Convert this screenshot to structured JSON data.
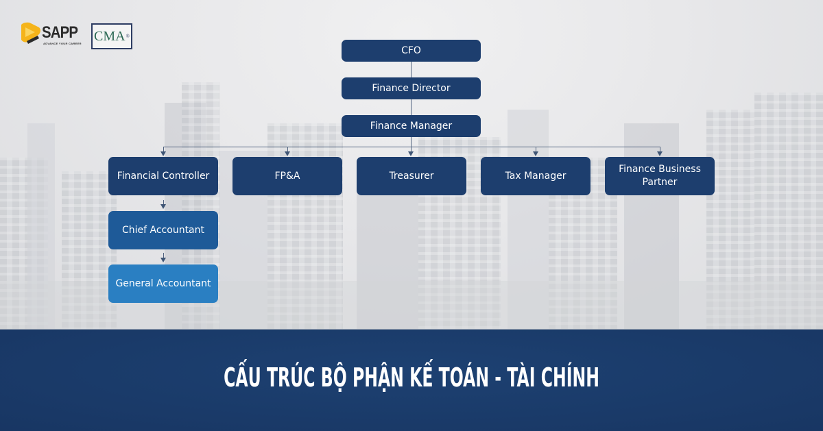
{
  "logos": {
    "sapp": {
      "name": "SAPP",
      "tagline": "ADVANCE YOUR CAREER",
      "accent": "#f5b41a"
    },
    "cma": {
      "name": "CMA",
      "mark": "®"
    }
  },
  "org_chart": {
    "top_chain": [
      {
        "id": "cfo",
        "label": "CFO"
      },
      {
        "id": "finance-director",
        "label": "Finance Director"
      },
      {
        "id": "finance-manager",
        "label": "Finance Manager"
      }
    ],
    "reports": [
      {
        "id": "financial-controller",
        "label": "Financial Controller"
      },
      {
        "id": "fpa",
        "label": "FP&A"
      },
      {
        "id": "treasurer",
        "label": "Treasurer"
      },
      {
        "id": "tax-manager",
        "label": "Tax Manager"
      },
      {
        "id": "finance-business-partner",
        "label": "Finance Business Partner"
      }
    ],
    "controller_chain": [
      {
        "id": "chief-accountant",
        "label": "Chief Accountant"
      },
      {
        "id": "general-accountant",
        "label": "General Accountant"
      }
    ],
    "colors": {
      "node_dark": "#1d3e6e",
      "node_mid": "#1e5a98",
      "node_light": "#2a7fc2",
      "connector": "#51637f"
    }
  },
  "banner": {
    "title": "CẤU TRÚC BỘ PHẬN KẾ TOÁN - TÀI CHÍNH",
    "background": "#1a3a6a"
  }
}
